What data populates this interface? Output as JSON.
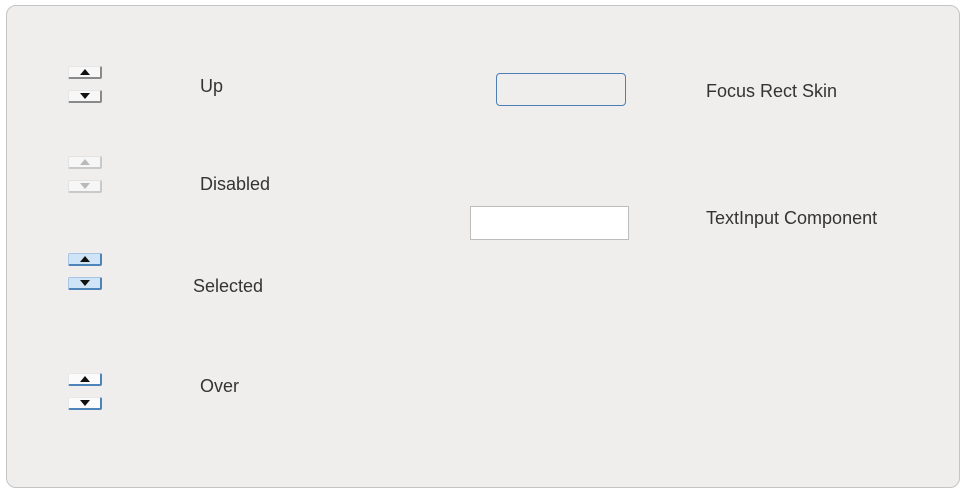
{
  "states": [
    {
      "id": "up",
      "label": "Up",
      "up_icon": "triangle-up-icon",
      "down_icon": "triangle-down-icon"
    },
    {
      "id": "disabled",
      "label": "Disabled",
      "up_icon": "triangle-up-icon",
      "down_icon": "triangle-down-icon"
    },
    {
      "id": "selected",
      "label": "Selected",
      "up_icon": "triangle-up-icon",
      "down_icon": "triangle-down-icon"
    },
    {
      "id": "over",
      "label": "Over",
      "up_icon": "triangle-up-icon",
      "down_icon": "triangle-down-icon"
    }
  ],
  "focus_rect": {
    "label": "Focus Rect Skin",
    "color": "#4d7fb5"
  },
  "text_input": {
    "label": "TextInput Component",
    "value": ""
  },
  "colors": {
    "panel_background": "#efeeec",
    "selected_fill": "#cfe4f7",
    "highlight_border": "#4e84b8"
  }
}
